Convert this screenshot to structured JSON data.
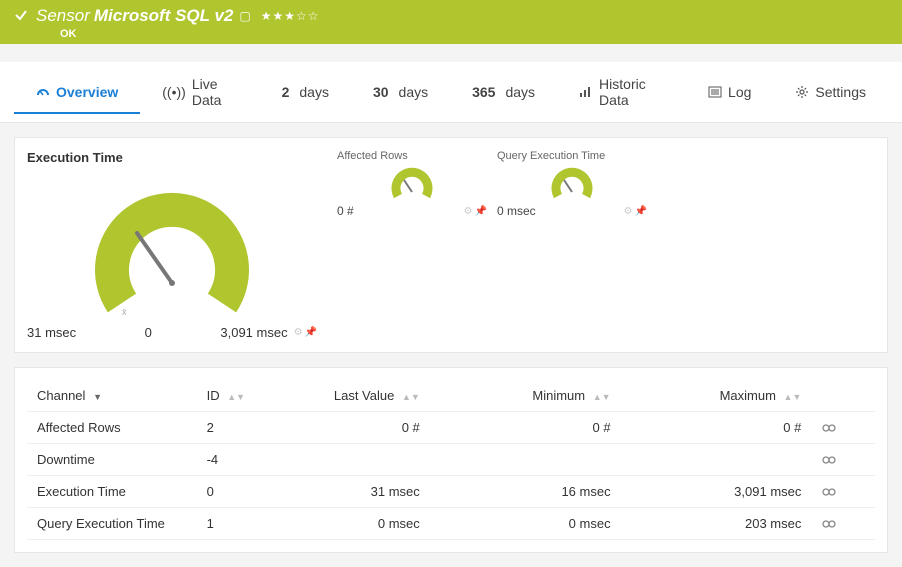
{
  "brand_color": "#b0c52e",
  "header": {
    "type_label": "Sensor",
    "name": "Microsoft SQL v2",
    "status": "OK",
    "rating_filled": 3,
    "rating_total": 5
  },
  "tabs": {
    "overview": "Overview",
    "live": "Live Data",
    "d2_num": "2",
    "d2_unit": "days",
    "d30_num": "30",
    "d30_unit": "days",
    "d365_num": "365",
    "d365_unit": "days",
    "historic": "Historic Data",
    "log": "Log",
    "settings": "Settings"
  },
  "main_gauge": {
    "label": "Execution Time",
    "value": "31 msec",
    "min": "0",
    "max": "3,091 msec"
  },
  "small_gauges": [
    {
      "label": "Affected Rows",
      "value": "0 #"
    },
    {
      "label": "Query Execution Time",
      "value": "0 msec"
    }
  ],
  "table": {
    "headers": {
      "channel": "Channel",
      "id": "ID",
      "last": "Last Value",
      "min": "Minimum",
      "max": "Maximum"
    },
    "rows": [
      {
        "channel": "Affected Rows",
        "id": "2",
        "last": "0 #",
        "min": "0 #",
        "max": "0 #"
      },
      {
        "channel": "Downtime",
        "id": "-4",
        "last": "",
        "min": "",
        "max": ""
      },
      {
        "channel": "Execution Time",
        "id": "0",
        "last": "31 msec",
        "min": "16 msec",
        "max": "3,091 msec"
      },
      {
        "channel": "Query Execution Time",
        "id": "1",
        "last": "0 msec",
        "min": "0 msec",
        "max": "203 msec"
      }
    ]
  },
  "chart_data": [
    {
      "type": "gauge",
      "label": "Execution Time",
      "value": 31,
      "min": 0,
      "max": 3091,
      "unit": "msec"
    },
    {
      "type": "gauge",
      "label": "Affected Rows",
      "value": 0,
      "min": 0,
      "max": 0,
      "unit": "#"
    },
    {
      "type": "gauge",
      "label": "Query Execution Time",
      "value": 0,
      "min": 0,
      "max": 0,
      "unit": "msec"
    }
  ]
}
